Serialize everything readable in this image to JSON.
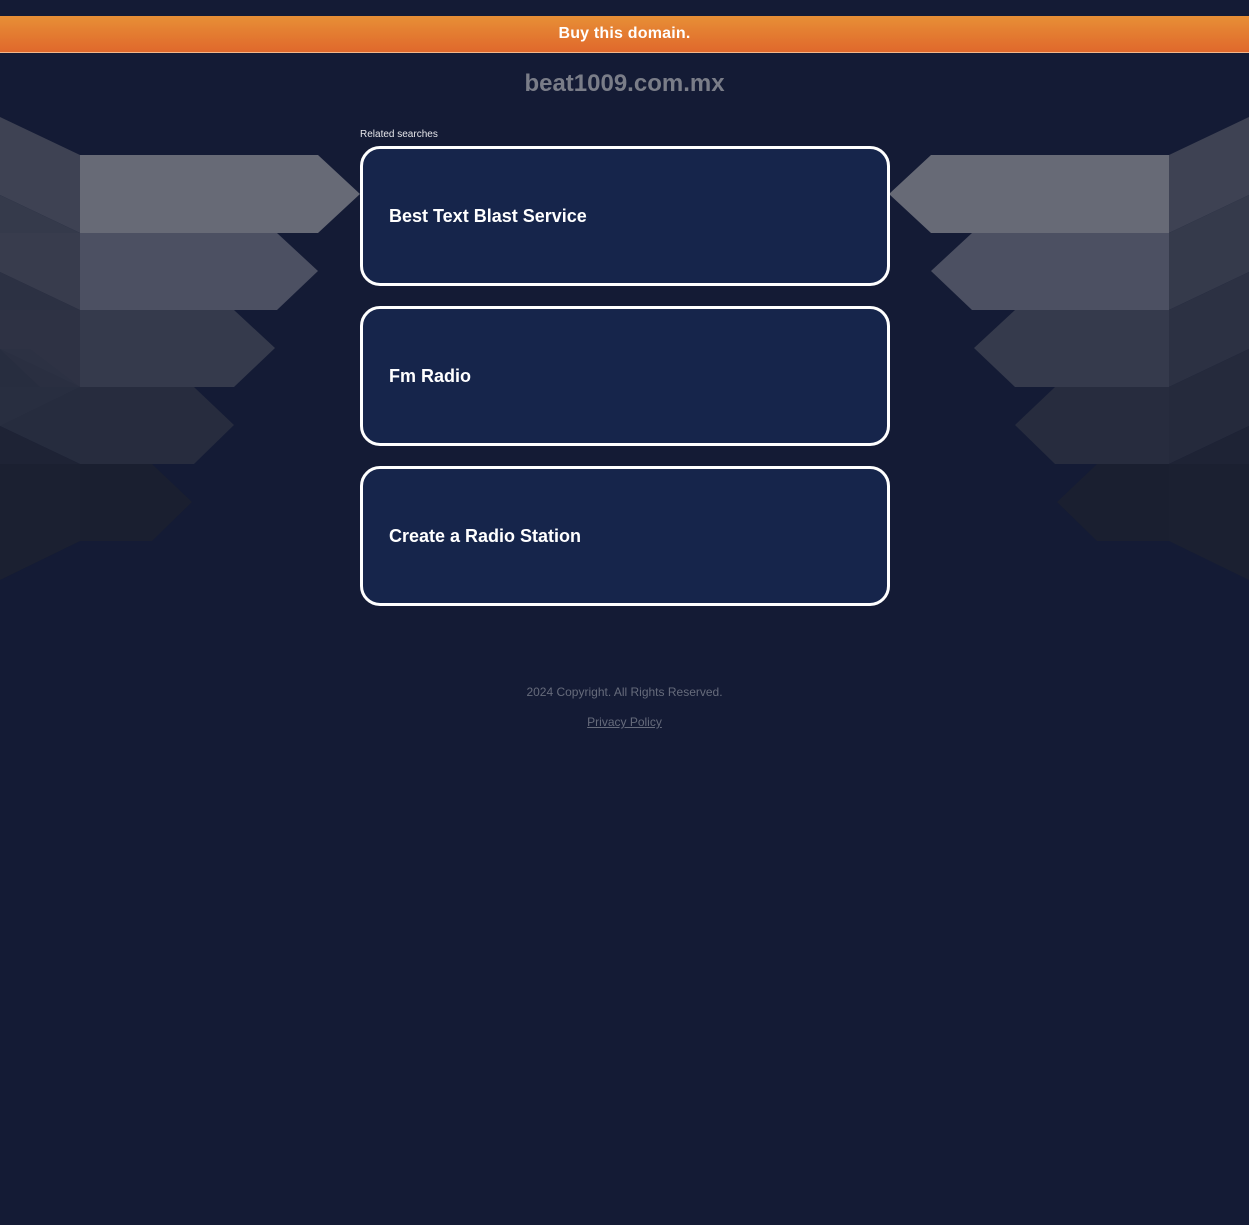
{
  "banner": {
    "label": "Buy this domain."
  },
  "header": {
    "domain": "beat1009.com.mx"
  },
  "related": {
    "label": "Related searches",
    "items": [
      {
        "label": "Best Text Blast Service"
      },
      {
        "label": "Fm Radio"
      },
      {
        "label": "Create a Radio Station"
      }
    ]
  },
  "footer": {
    "copyright": "2024 Copyright. All Rights Reserved.",
    "privacy_label": "Privacy Policy"
  },
  "colors": {
    "background": "#141b35",
    "banner_top": "#e78f36",
    "banner_bottom": "#e0682c",
    "card_fill": "#16254b",
    "card_border": "#ffffff",
    "title_text": "#7a7d88",
    "footer_text": "#666b7b"
  }
}
